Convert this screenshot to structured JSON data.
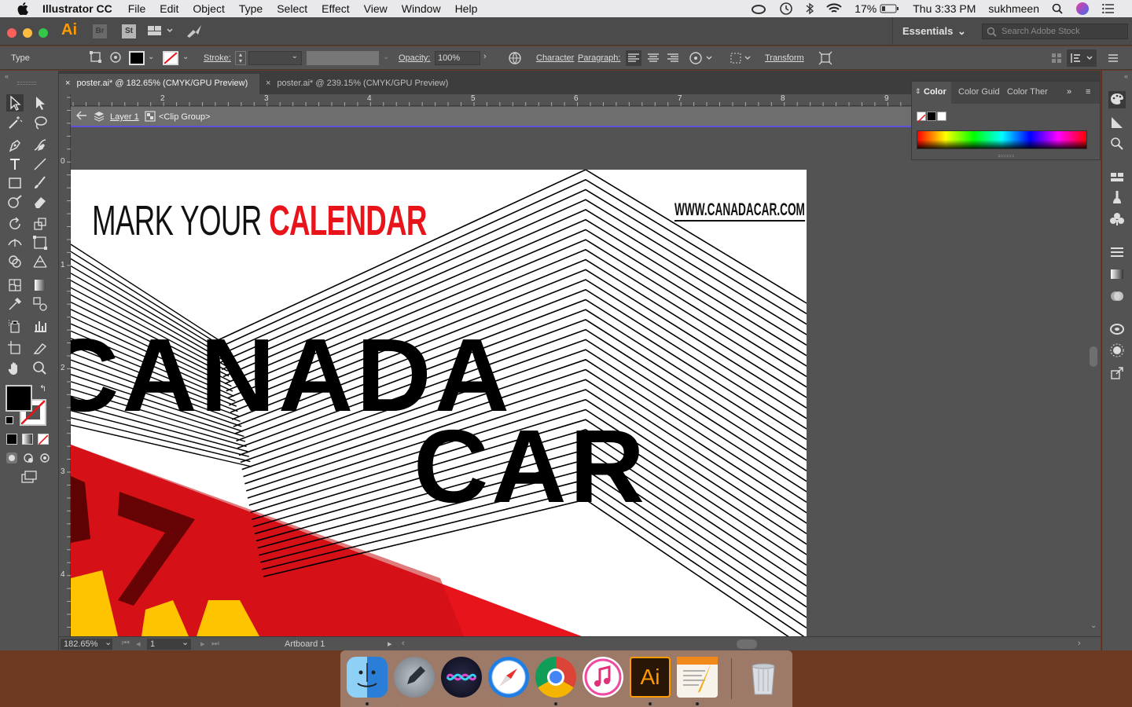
{
  "menubar": {
    "app_name": "Illustrator CC",
    "menus": [
      "File",
      "Edit",
      "Object",
      "Type",
      "Select",
      "Effect",
      "View",
      "Window",
      "Help"
    ],
    "battery": "17%",
    "clock": "Thu 3:33 PM",
    "user": "sukhmeen"
  },
  "appbar": {
    "logo": "Ai",
    "bridge": "Br",
    "stock": "St",
    "workspace": "Essentials",
    "search_placeholder": "Search Adobe Stock"
  },
  "controlbar": {
    "selection_type": "Type",
    "stroke_label": "Stroke:",
    "opacity_label": "Opacity:",
    "opacity_value": "100%",
    "character_label": "Character",
    "paragraph_label": "Paragraph:",
    "transform_label": "Transform"
  },
  "tabs": [
    {
      "label": "poster.ai* @ 182.65% (CMYK/GPU Preview)",
      "active": true
    },
    {
      "label": "poster.ai* @ 239.15% (CMYK/GPU Preview)",
      "active": false
    }
  ],
  "ruler": {
    "h_labels": [
      "2",
      "3",
      "4",
      "5",
      "6",
      "7",
      "8",
      "9"
    ],
    "v_labels": [
      "0",
      "1",
      "2",
      "3",
      "4"
    ]
  },
  "isolation": {
    "layer": "Layer 1",
    "group": "<Clip Group>"
  },
  "artwork": {
    "headline_light": "MARK YOUR ",
    "headline_bold": "CALENDAR",
    "website": "WWW.CANADACAR.COM",
    "title_line1": "CANADA",
    "title_line2": "CAR",
    "accent_color": "#e8141b",
    "yellow_color": "#ffc400"
  },
  "color_panel": {
    "tabs": [
      "Color",
      "Color Guid",
      "Color Ther"
    ]
  },
  "statusbar": {
    "zoom": "182.65%",
    "page": "1",
    "artboard_name": "Artboard 1"
  },
  "dock": {
    "apps": [
      "Finder",
      "Launchpad",
      "Siri",
      "Safari",
      "Chrome",
      "iTunes",
      "Illustrator",
      "Pages",
      "Trash"
    ],
    "illustrator_label": "Ai"
  }
}
